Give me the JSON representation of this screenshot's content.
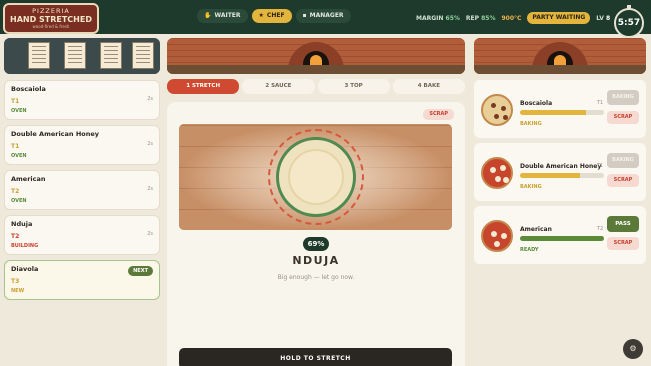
{
  "header": {
    "logo_line1": "PIZZERIA",
    "logo_line2": "HAND STRETCHED",
    "logo_line3": "wood-fired & fresh",
    "roles": [
      {
        "label": "WAITER",
        "icon": "hand-icon",
        "glyph": "✋",
        "active": false
      },
      {
        "label": "CHEF",
        "icon": "chef-hat-icon",
        "glyph": "★",
        "active": true
      },
      {
        "label": "MANAGER",
        "icon": "chat-icon",
        "glyph": "▪",
        "active": false
      }
    ],
    "margin_label": "MARGIN",
    "margin_value": "65%",
    "rep_label": "REP",
    "rep_value": "85%",
    "oven_temp": "900°C",
    "party_label": "PARTY WAITING",
    "level_label": "LV",
    "level_value": "8",
    "pause_glyph": "❚❚",
    "timer": "5:57"
  },
  "orders": [
    {
      "name": "Boscaiola",
      "table": "T1",
      "status": "OVEN",
      "age": "2s"
    },
    {
      "name": "Double American Honey",
      "table": "T1",
      "status": "OVEN",
      "age": "2s"
    },
    {
      "name": "American",
      "table": "T2",
      "status": "OVEN",
      "age": "2s"
    },
    {
      "name": "Nduja",
      "table": "T2",
      "status": "BUILDING",
      "age": "2s"
    },
    {
      "name": "Diavola",
      "table": "T3",
      "status": "NEW",
      "badge": "NEXT"
    }
  ],
  "steps": [
    {
      "label": "1 STRETCH",
      "active": true
    },
    {
      "label": "2 SAUCE",
      "active": false
    },
    {
      "label": "3 TOP",
      "active": false
    },
    {
      "label": "4 BAKE",
      "active": false
    }
  ],
  "work": {
    "scrap_label": "SCRAP",
    "stretch_percent": "69%",
    "pizza_name": "NDUJA",
    "hint": "Big enough — let go now.",
    "hold_label": "HOLD TO STRETCH"
  },
  "oven_slots": [
    {
      "name": "Boscaiola",
      "table": "T1",
      "status": "BAKING",
      "progress": 0.78,
      "action": "BAKING",
      "scrap": "SCRAP"
    },
    {
      "name": "Double American Honey",
      "table": "T1",
      "status": "BAKING",
      "progress": 0.72,
      "action": "BAKING",
      "scrap": "SCRAP"
    },
    {
      "name": "American",
      "table": "T2",
      "status": "READY",
      "progress": 1.0,
      "action": "PASS",
      "scrap": "SCRAP"
    }
  ],
  "fab_icon": "settings-icon",
  "colors": {
    "header_bg": "#1e3a2c",
    "accent_red": "#cf4a30",
    "accent_gold": "#e4b53c",
    "accent_green": "#5b8a3a"
  }
}
